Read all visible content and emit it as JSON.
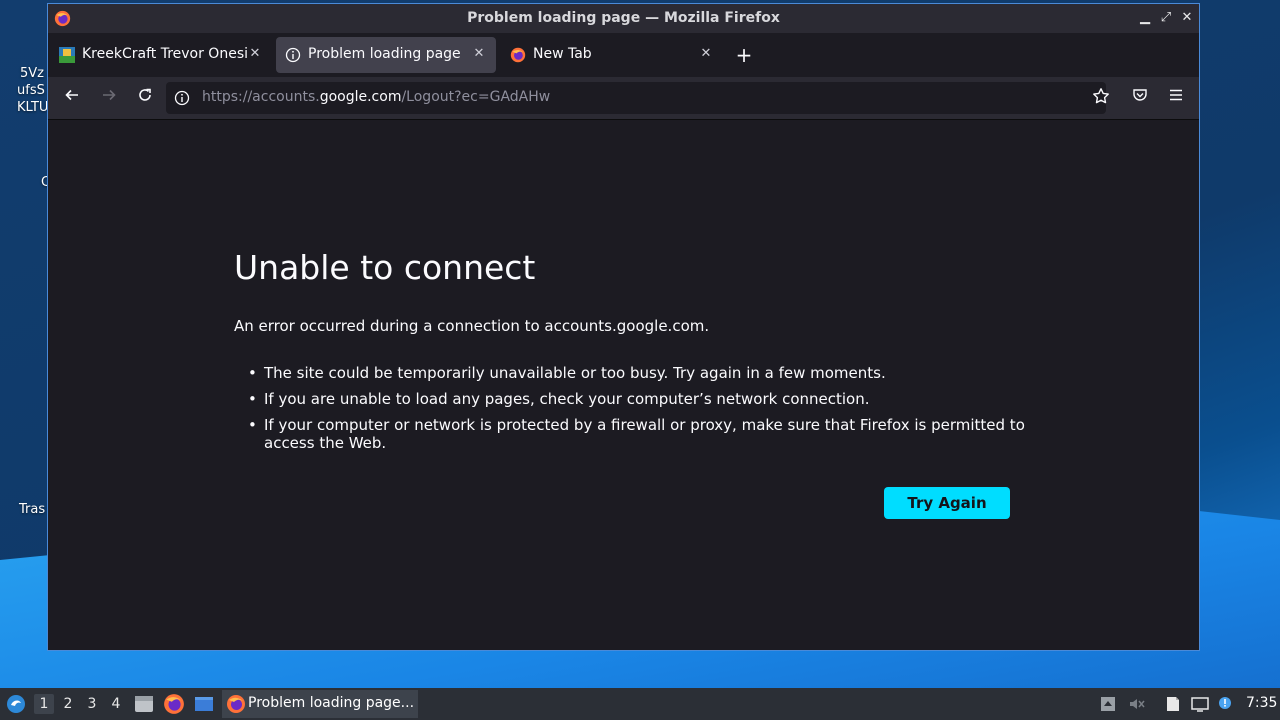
{
  "desktop": {
    "icon_labels": [
      "5Vz",
      "ufsS",
      "KLTU",
      "C",
      "Tras"
    ]
  },
  "window": {
    "title": "Problem loading page — Mozilla Firefox",
    "controls": {
      "minimize": "▁",
      "maximize": "⤢",
      "close": "✕"
    }
  },
  "tabs": [
    {
      "label": "KreekCraft Trevor Onesie",
      "icon": "kreekcraft-favicon"
    },
    {
      "label": "Problem loading page",
      "icon": "info-icon",
      "active": true
    },
    {
      "label": "New Tab",
      "icon": "firefox-icon"
    }
  ],
  "new_tab_label": "+",
  "navbar": {
    "url_prefix": "https://accounts.",
    "url_host": "google.com",
    "url_path": "/Logout?ec=GAdAHw"
  },
  "error": {
    "title": "Unable to connect",
    "description": "An error occurred during a connection to accounts.google.com.",
    "items": [
      "The site could be temporarily unavailable or too busy. Try again in a few moments.",
      "If you are unable to load any pages, check your computer’s network connection.",
      "If your computer or network is protected by a firewall or proxy, make sure that Firefox is permitted to access the Web."
    ],
    "button": "Try Again"
  },
  "taskbar": {
    "workspaces": [
      "1",
      "2",
      "3",
      "4"
    ],
    "task_label": "Problem loading page...",
    "clock": "7:35"
  },
  "colors": {
    "accent": "#00ddff",
    "page_bg": "#1c1b22",
    "toolbar_bg": "#2b2a33",
    "window_border": "#4a8ad8"
  }
}
